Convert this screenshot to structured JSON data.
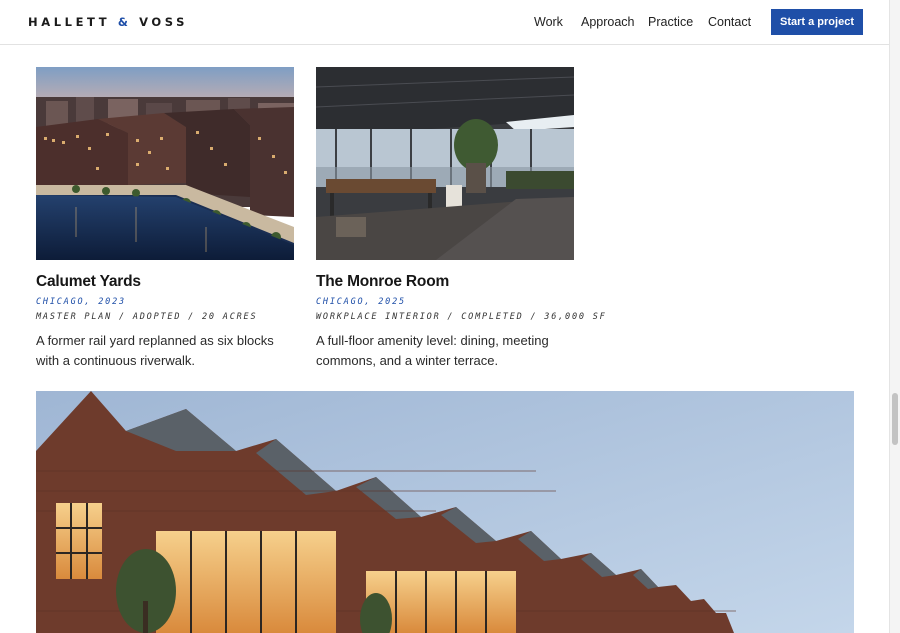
{
  "brand": {
    "name_left": "HALLETT",
    "amp": "&",
    "name_right": "VOSS"
  },
  "nav": {
    "work": "Work",
    "approach": "Approach",
    "practice": "Practice",
    "contact": "Contact",
    "cta": "Start a project"
  },
  "projects": [
    {
      "title": "Calumet Yards",
      "meta": "CHICAGO, 2023",
      "specs": "MASTER PLAN / ADOPTED / 20 ACRES",
      "description": "A former rail yard replanned as six blocks with a continuous riverwalk.",
      "image": "aerial-riverfront-photo"
    },
    {
      "title": "The Monroe Room",
      "meta": "CHICAGO, 2025",
      "specs": "WORKPLACE INTERIOR / COMPLETED / 36,000 SF",
      "description": "A full-floor amenity level: dining, meeting commons, and a winter terrace.",
      "image": "interior-amenity-photo"
    }
  ],
  "feature": {
    "image": "sawtooth-brick-building-photo"
  },
  "colors": {
    "accent": "#1f4fa8",
    "text": "#1a1a1a",
    "rule": "#e2e2e2"
  }
}
